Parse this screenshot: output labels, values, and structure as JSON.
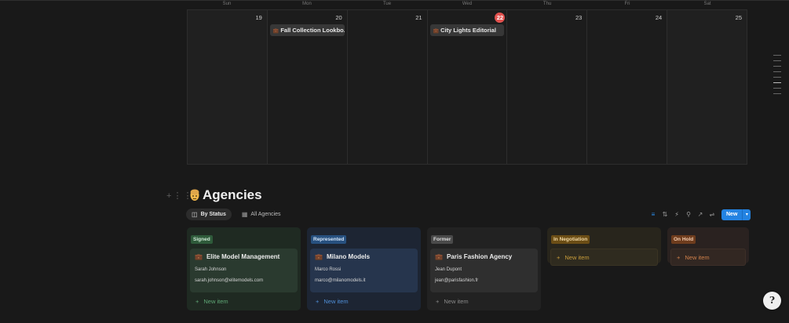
{
  "calendar": {
    "weekdays": [
      "Sun",
      "Mon",
      "Tue",
      "Wed",
      "Thu",
      "Fri",
      "Sat"
    ],
    "days": [
      {
        "num": "19",
        "today": false,
        "event": null
      },
      {
        "num": "20",
        "today": false,
        "event": "Fall Collection Lookbo..."
      },
      {
        "num": "21",
        "today": false,
        "event": null
      },
      {
        "num": "22",
        "today": true,
        "event": "City Lights Editorial"
      },
      {
        "num": "23",
        "today": false,
        "event": null
      },
      {
        "num": "24",
        "today": false,
        "event": null
      },
      {
        "num": "25",
        "today": false,
        "event": null
      }
    ]
  },
  "section": {
    "title": "Agencies",
    "icon": "bust-in-silhouette-icon"
  },
  "tabs": [
    {
      "label": "By Status",
      "icon": "board-icon",
      "active": true
    },
    {
      "label": "All Agencies",
      "icon": "table-icon",
      "active": false
    }
  ],
  "toolbar": {
    "new_label": "New",
    "accent": "#2383e2"
  },
  "board": {
    "columns": [
      {
        "status": "Signed",
        "color": "#2e5a3a",
        "card": {
          "name": "Elite Model Management",
          "contact": "Sarah Johnson",
          "email": "sarah.johnson@elitemodels.com"
        },
        "new_item": "New item"
      },
      {
        "status": "Represented",
        "color": "#27507f",
        "card": {
          "name": "Milano Models",
          "contact": "Marco Rossi",
          "email": "marco@milanomodels.it"
        },
        "new_item": "New item"
      },
      {
        "status": "Former",
        "color": "#4a4a4a",
        "card": {
          "name": "Paris Fashion Agency",
          "contact": "Jean Dupont",
          "email": "jean@parisfashion.fr"
        },
        "new_item": "New item"
      },
      {
        "status": "In Negotiation",
        "color": "#6b4d15",
        "card": null,
        "new_item": "New item"
      },
      {
        "status": "On Hold",
        "color": "#6e3c1d",
        "card": null,
        "new_item": "New item"
      }
    ]
  },
  "help": {
    "label": "?"
  }
}
